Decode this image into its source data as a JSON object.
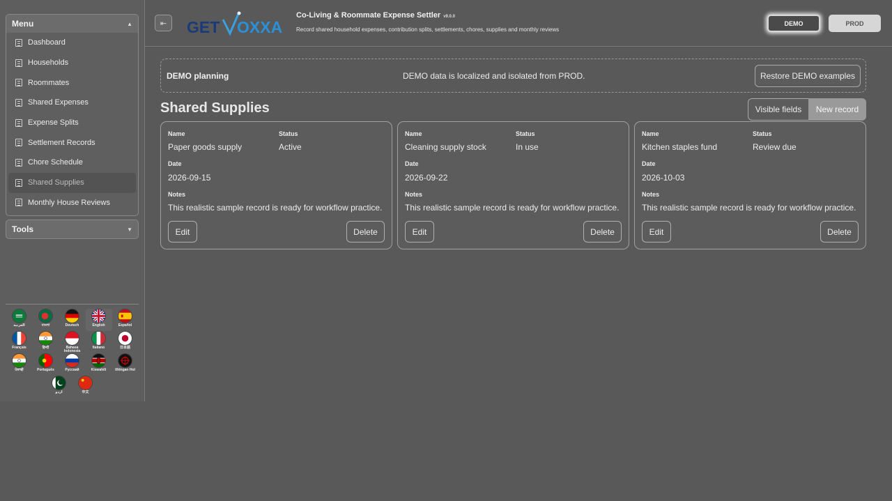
{
  "sidebar": {
    "menu_title": "Menu",
    "items": [
      {
        "label": "Dashboard"
      },
      {
        "label": "Households"
      },
      {
        "label": "Roommates"
      },
      {
        "label": "Shared Expenses"
      },
      {
        "label": "Expense Splits"
      },
      {
        "label": "Settlement Records"
      },
      {
        "label": "Chore Schedule"
      },
      {
        "label": "Shared Supplies",
        "active": true
      },
      {
        "label": "Monthly House Reviews"
      }
    ],
    "tools_title": "Tools",
    "languages": [
      {
        "label": "العربية",
        "flag": "sa"
      },
      {
        "label": "বাংলা",
        "flag": "bd"
      },
      {
        "label": "Deutsch",
        "flag": "de"
      },
      {
        "label": "English",
        "flag": "gb",
        "selected": true
      },
      {
        "label": "Español",
        "flag": "es"
      },
      {
        "label": "Français",
        "flag": "fr"
      },
      {
        "label": "हिन्दी",
        "flag": "in"
      },
      {
        "label": "Bahasa Indonesia",
        "flag": "id"
      },
      {
        "label": "Italiano",
        "flag": "it"
      },
      {
        "label": "日本語",
        "flag": "jp"
      },
      {
        "label": "ਪੰਜਾਬੀ",
        "flag": "in"
      },
      {
        "label": "Português",
        "flag": "pt"
      },
      {
        "label": "Русский",
        "flag": "ru"
      },
      {
        "label": "Kiswahili",
        "flag": "ke"
      },
      {
        "label": "tlhIngan Hol",
        "flag": "kl"
      },
      {
        "label": "اردو",
        "flag": "pk"
      },
      {
        "label": "中文",
        "flag": "cn"
      }
    ]
  },
  "header": {
    "logo_text_left": "GET",
    "logo_text_right": "OXXA",
    "title": "Co-Living & Roommate Expense Settler",
    "version": "v9.0.0",
    "subtitle": "Record shared household expenses, contribution splits, settlements, chores, supplies and monthly reviews",
    "demo_label": "DEMO",
    "prod_label": "PROD"
  },
  "banner": {
    "title": "DEMO planning",
    "message": "DEMO data is localized and isolated from PROD.",
    "restore_label": "Restore DEMO examples"
  },
  "section": {
    "title": "Shared Supplies",
    "visible_fields_label": "Visible fields",
    "new_record_label": "New record"
  },
  "field_labels": {
    "name": "Name",
    "status": "Status",
    "date": "Date",
    "notes": "Notes"
  },
  "records": [
    {
      "name": "Paper goods supply",
      "status": "Active",
      "date": "2026-09-15",
      "notes": "This realistic sample record is ready for workflow practice.",
      "edit": "Edit",
      "delete": "Delete"
    },
    {
      "name": "Cleaning supply stock",
      "status": "In use",
      "date": "2026-09-22",
      "notes": "This realistic sample record is ready for workflow practice.",
      "edit": "Edit",
      "delete": "Delete"
    },
    {
      "name": "Kitchen staples fund",
      "status": "Review due",
      "date": "2026-10-03",
      "notes": "This realistic sample record is ready for workflow practice.",
      "edit": "Edit",
      "delete": "Delete"
    }
  ]
}
